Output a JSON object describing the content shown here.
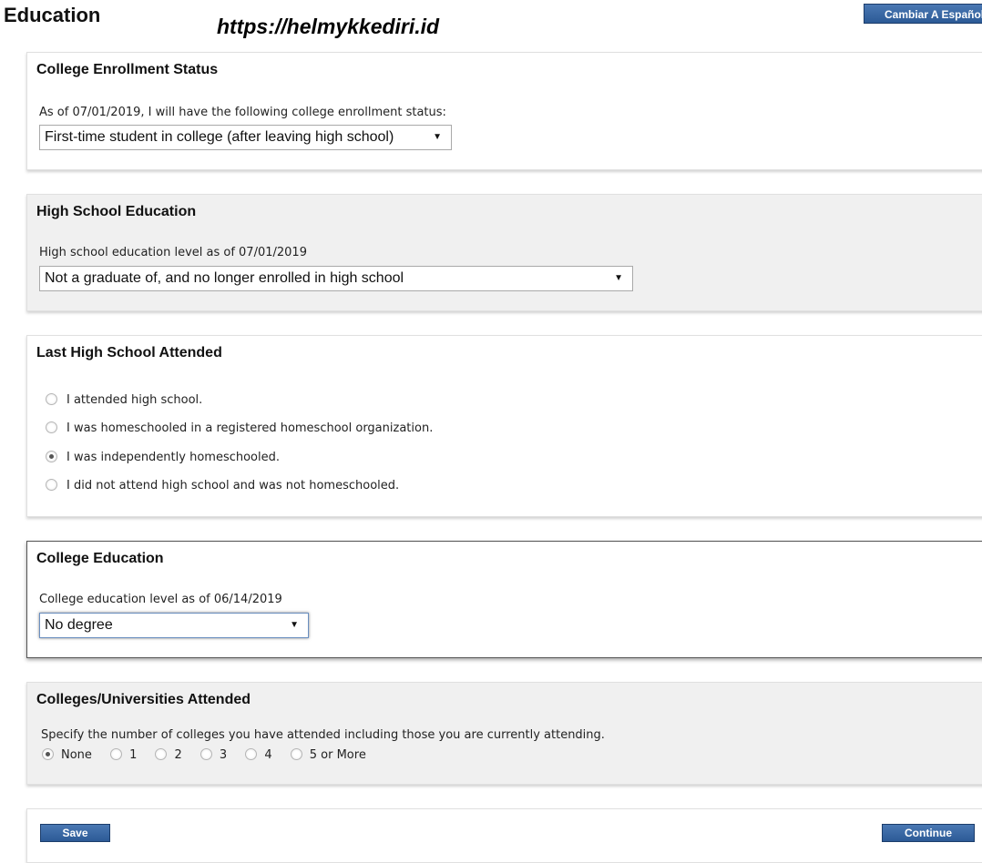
{
  "header": {
    "title": "Education",
    "watermark": "https://helmykkediri.id",
    "language_button": "Cambiar A Español"
  },
  "college_enrollment": {
    "heading": "College Enrollment Status",
    "label": "As of 07/01/2019, I will have the following college enrollment status:",
    "selected": "First-time student in college (after leaving high school)"
  },
  "high_school": {
    "heading": "High School Education",
    "label": "High school education level as of 07/01/2019",
    "selected": "Not a graduate of, and no longer enrolled in high school"
  },
  "last_high_school": {
    "heading": "Last High School Attended",
    "options": [
      {
        "label": "I attended high school.",
        "checked": false
      },
      {
        "label": "I was homeschooled in a registered homeschool organization.",
        "checked": false
      },
      {
        "label": "I was independently homeschooled.",
        "checked": true
      },
      {
        "label": "I did not attend high school and was not homeschooled.",
        "checked": false
      }
    ]
  },
  "college_education": {
    "heading": "College Education",
    "label": "College education level as of 06/14/2019",
    "selected": "No degree"
  },
  "colleges_attended": {
    "heading": "Colleges/Universities Attended",
    "label": "Specify the number of colleges you have attended including those you are currently attending.",
    "options": [
      {
        "label": "None",
        "checked": true
      },
      {
        "label": "1",
        "checked": false
      },
      {
        "label": "2",
        "checked": false
      },
      {
        "label": "3",
        "checked": false
      },
      {
        "label": "4",
        "checked": false
      },
      {
        "label": "5 or More",
        "checked": false
      }
    ]
  },
  "footer": {
    "save_label": "Save",
    "continue_label": "Continue"
  },
  "colors": {
    "button_blue": "#2c5a96",
    "panel_gray": "#f0f0f0"
  }
}
